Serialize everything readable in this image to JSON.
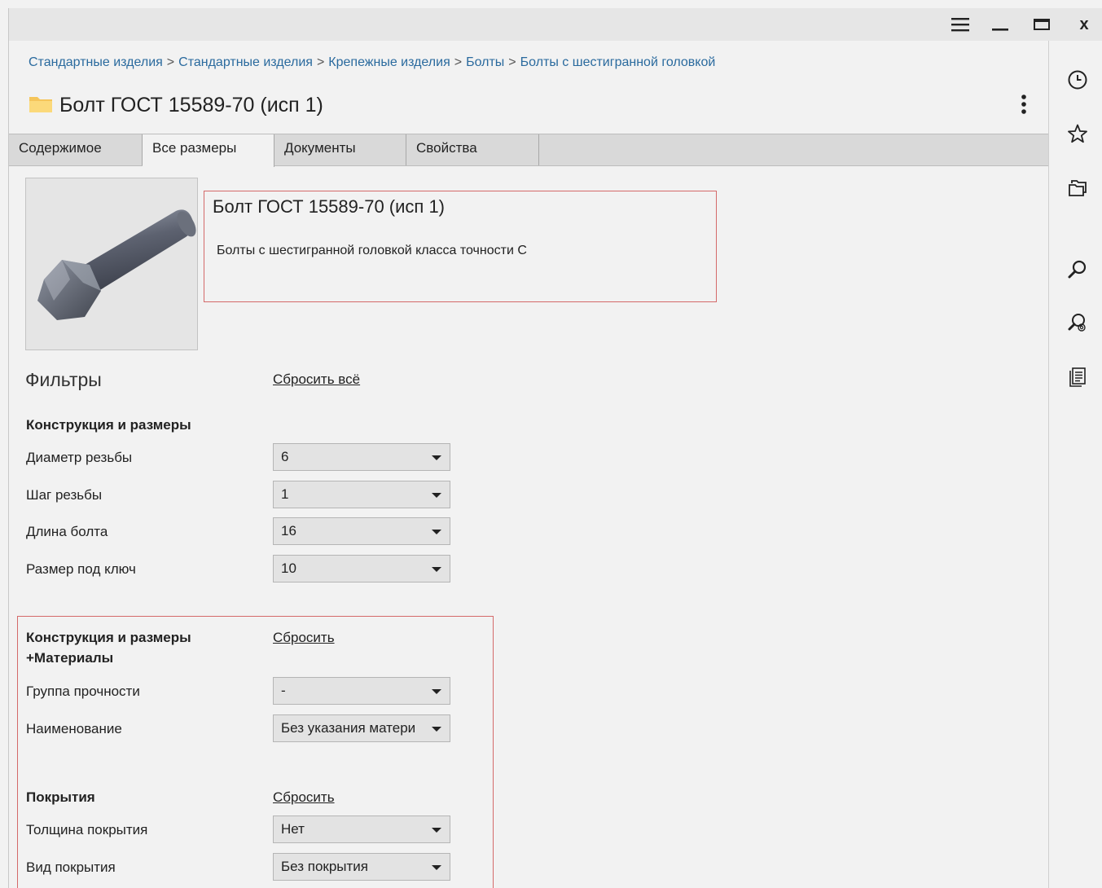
{
  "window": {
    "controls": [
      "menu-icon",
      "minimize-icon",
      "maximize-icon",
      "close-icon"
    ],
    "close_label": "x"
  },
  "breadcrumb": [
    "Стандартные изделия",
    "Стандартные изделия",
    "Крепежные изделия",
    "Болты",
    "Болты с шестигранной головкой"
  ],
  "breadcrumb_separator": ">",
  "page": {
    "title": "Болт ГОСТ 15589-70 (исп 1)",
    "title_icon": "folder-icon",
    "more_icon": "more-vertical-icon"
  },
  "tabs": [
    {
      "label": "Содержимое",
      "active": false
    },
    {
      "label": "Все размеры",
      "active": true
    },
    {
      "label": "Документы",
      "active": false
    },
    {
      "label": "Свойства",
      "active": false
    }
  ],
  "product": {
    "image": "bolt-image",
    "name": "Болт ГОСТ 15589-70 (исп 1)",
    "description": "Болты с шестигранной головкой класса точности С"
  },
  "filters": {
    "title": "Фильтры",
    "reset_all": "Сбросить всё",
    "groups": [
      {
        "title": "Конструкция и размеры",
        "reset": "",
        "fields": [
          {
            "label": "Диаметр резьбы",
            "value": "6"
          },
          {
            "label": "Шаг резьбы",
            "value": "1"
          },
          {
            "label": "Длина болта",
            "value": "16"
          },
          {
            "label": "Размер под ключ",
            "value": "10"
          }
        ]
      },
      {
        "title": "Конструкция и размеры +Материалы",
        "reset": "Сбросить",
        "fields": [
          {
            "label": "Группа прочности",
            "value": "-"
          },
          {
            "label": "Наименование",
            "value": "Без указания матери"
          }
        ]
      },
      {
        "title": "Покрытия",
        "reset": "Сбросить",
        "fields": [
          {
            "label": "Толщина покрытия",
            "value": "Нет"
          },
          {
            "label": "Вид покрытия",
            "value": "Без покрытия"
          }
        ]
      }
    ]
  },
  "sidebar": {
    "icons": [
      "clock-icon",
      "star-icon",
      "folders-icon",
      "search-icon",
      "fingerprint-search-icon",
      "document-list-icon"
    ]
  },
  "colors": {
    "link": "#2a6a9e",
    "highlight_border": "#d46a6a",
    "folder": "#f5c55a"
  }
}
